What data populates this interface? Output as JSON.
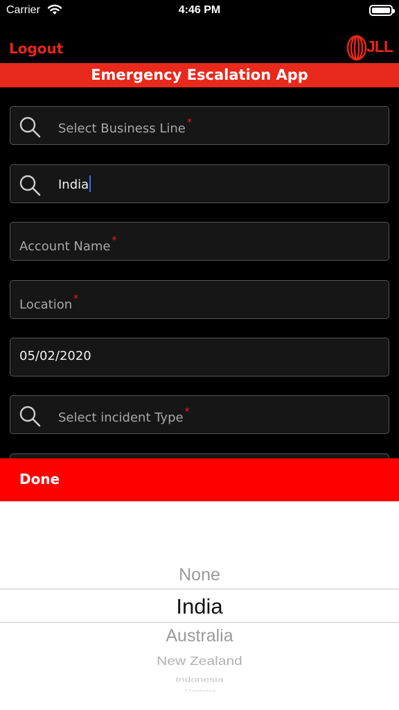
{
  "status_bar": {
    "carrier": "Carrier",
    "time": "4:46 PM"
  },
  "header": {
    "logout_label": "Logout",
    "logo_text": "JLL",
    "title": "Emergency Escalation App"
  },
  "form": {
    "business_line": {
      "placeholder": "Select Business Line",
      "required_mark": "*"
    },
    "country": {
      "value": "India"
    },
    "account_name": {
      "placeholder": "Account Name",
      "required_mark": "*"
    },
    "location": {
      "placeholder": "Location",
      "required_mark": "*"
    },
    "date": {
      "value": "05/02/2020"
    },
    "incident_type": {
      "placeholder": "Select incident Type",
      "required_mark": "*"
    }
  },
  "picker": {
    "done_label": "Done",
    "selected": "India",
    "options": [
      "None",
      "India",
      "Australia",
      "New Zealand",
      "Indonesia",
      "Thailand"
    ]
  },
  "colors": {
    "accent_red": "#e8291c",
    "done_red": "#ff0000",
    "field_bg": "#161616",
    "caret_blue": "#3c6cff"
  }
}
